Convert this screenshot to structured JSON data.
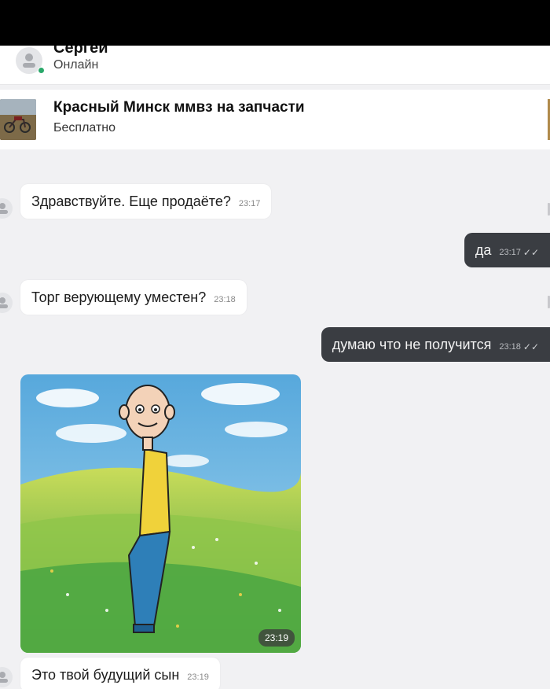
{
  "header": {
    "contact_name": "Сергей",
    "status": "Онлайн"
  },
  "ad": {
    "title": "Красный Минск ммвз на запчасти",
    "price": "Бесплатно"
  },
  "messages": [
    {
      "direction": "in",
      "text": "Здравствуйте. Еще продаёте?",
      "time": "23:17"
    },
    {
      "direction": "out",
      "text": "да",
      "time": "23:17"
    },
    {
      "direction": "in",
      "text": "Торг верующему уместен?",
      "time": "23:18"
    },
    {
      "direction": "out",
      "text": "думаю что не получится",
      "time": "23:18"
    },
    {
      "direction": "in",
      "type": "image",
      "time": "23:19"
    },
    {
      "direction": "in",
      "text": "Это твой будущий сын",
      "time": "23:19"
    }
  ],
  "colors": {
    "outgoing_bubble": "#3a3d42",
    "incoming_bubble": "#ffffff",
    "online_dot": "#2aa86a",
    "chat_background": "#f1f1f3"
  }
}
